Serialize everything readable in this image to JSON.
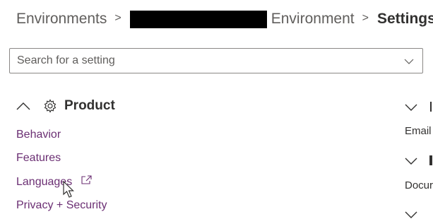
{
  "breadcrumb": {
    "item1": "Environments",
    "separator": ">",
    "item2": "Environment",
    "current": "Settings"
  },
  "search": {
    "placeholder": "Search for a setting"
  },
  "product_section": {
    "title": "Product",
    "links": [
      "Behavior",
      "Features",
      "Languages",
      "Privacy + Security"
    ]
  },
  "right_column": {
    "text1": "Email",
    "text2": "Docur"
  },
  "colors": {
    "link": "#6b2f73",
    "text": "#323130",
    "muted": "#605e5c",
    "border": "#8a8886"
  },
  "icons": [
    "chevron-right-icon",
    "chevron-down-icon",
    "chevron-up-icon",
    "gear-icon",
    "external-link-icon",
    "mouse-pointer-icon"
  ]
}
